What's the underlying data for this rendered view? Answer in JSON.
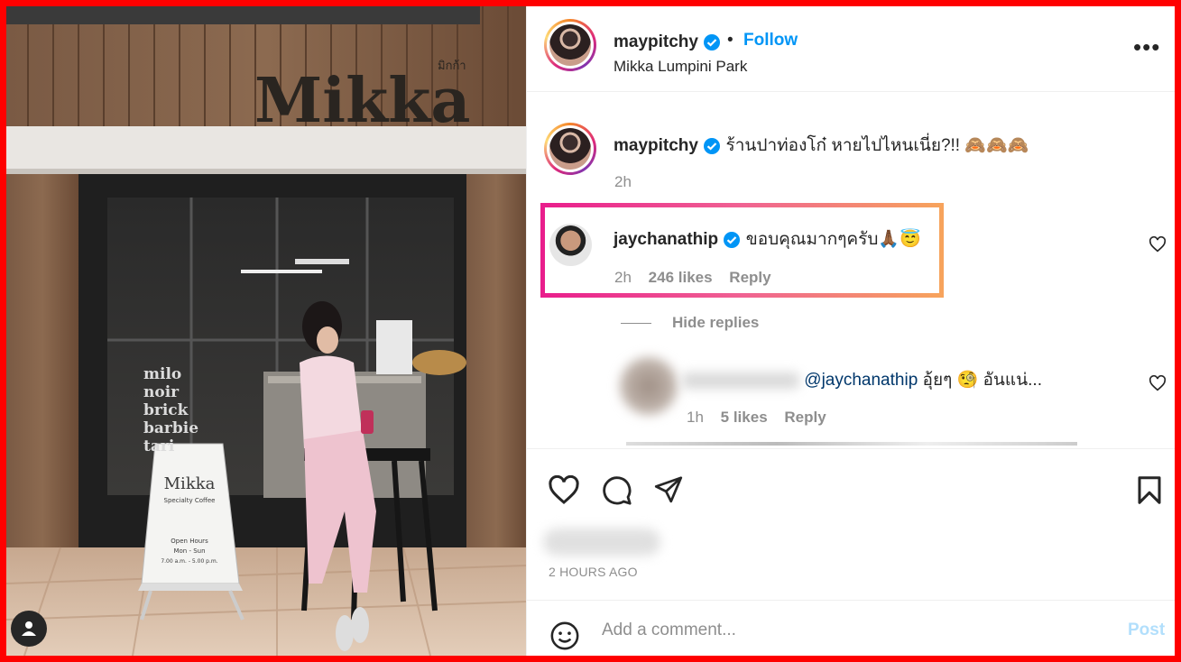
{
  "post": {
    "username": "maypitchy",
    "follow_label": "Follow",
    "separator": "•",
    "location": "Mikka Lumpini Park",
    "more_label": "•••"
  },
  "photo": {
    "shop_sign": "Mikka",
    "shop_sign_small": "มิกก้า",
    "menu_lines": [
      "milo",
      "noir",
      "brick",
      "barbie",
      "tari"
    ],
    "board_title": "Mikka",
    "board_subtitle": "Specialty Coffee",
    "board_hours_label": "Open Hours",
    "board_days": "Mon - Sun",
    "board_time": "7.00 a.m. - 5.00 p.m."
  },
  "caption": {
    "username": "maypitchy",
    "text": "ร้านปาท่องโก๋ หายไปไหนเนี่ย?!! 🙈🙈🙈",
    "time": "2h"
  },
  "comment": {
    "username": "jaychanathip",
    "text": "ขอบคุณมากๆครับ🙏🏾😇",
    "time": "2h",
    "likes": "246 likes",
    "reply_label": "Reply",
    "hide_replies_label": "Hide replies"
  },
  "reply": {
    "mention": "@jaychanathip",
    "text": "อุ้ยๆ 🧐 อันแน่...",
    "time": "1h",
    "likes": "5 likes",
    "reply_label": "Reply"
  },
  "footer": {
    "timestamp": "2 HOURS AGO",
    "comment_placeholder": "Add a comment...",
    "post_label": "Post"
  },
  "colors": {
    "accent": "#0095f6",
    "border": "#ff0000",
    "highlight_start": "#e91e8c",
    "highlight_end": "#f7a35c"
  }
}
